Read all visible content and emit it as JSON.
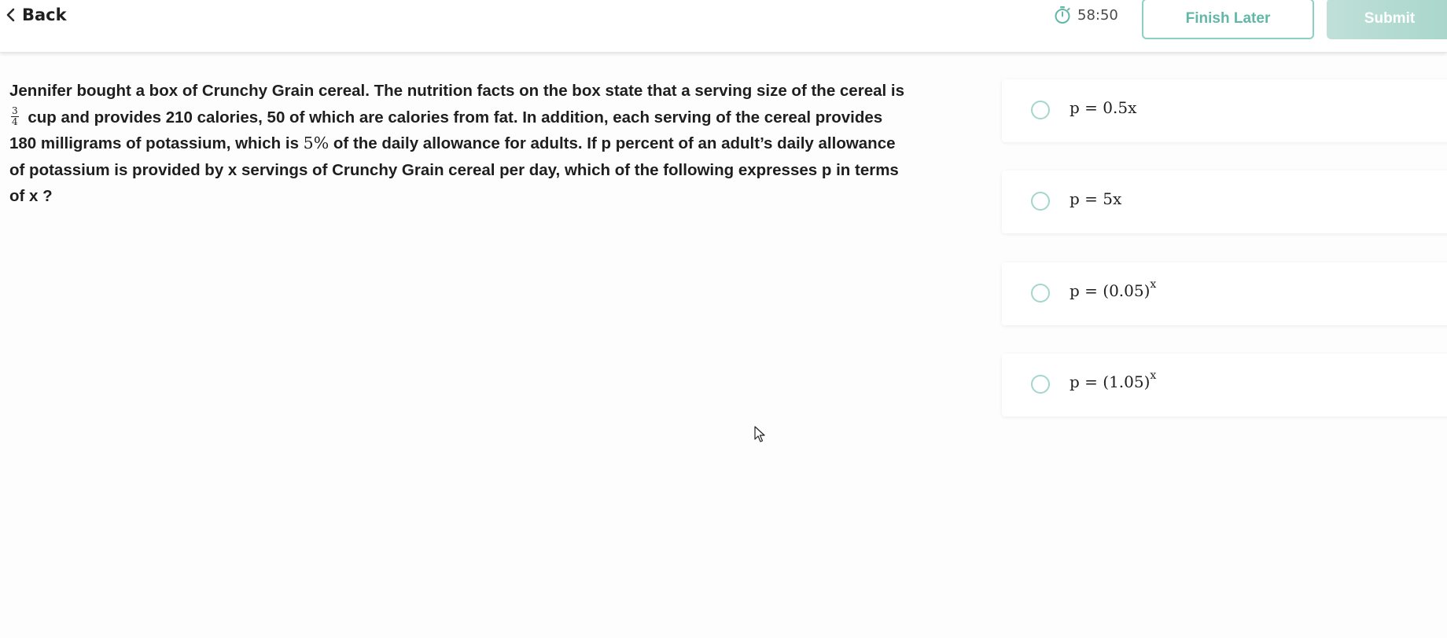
{
  "header": {
    "back_label": "Back",
    "timer": "58:50",
    "finish_later_label": "Finish Later",
    "submit_label": "Submit"
  },
  "question": {
    "line1": "Jennifer bought a box of Crunchy Grain cereal. The nutrition facts on the box state that a serving size of the cereal is",
    "fraction_numerator": "3",
    "fraction_denominator": "4",
    "line2_rest": " cup and provides 210 calories, 50 of which are calories from fat. In addition, each serving of the cereal provides",
    "line3_a": "180 milligrams of potassium, which is ",
    "line3_math": "5%",
    "line3_b": " of the daily allowance for adults. If p percent of an adult’s daily allowance",
    "line4": "of potassium is provided by x servings of Crunchy Grain cereal per day, which of the following expresses p in terms",
    "line5": "of x ?"
  },
  "choices": [
    {
      "text": "p = 0.5x",
      "exponent": ""
    },
    {
      "text": "p = 5x",
      "exponent": ""
    },
    {
      "text": "p = (0.05)",
      "exponent": "x"
    },
    {
      "text": "p = (1.05)",
      "exponent": "x"
    }
  ],
  "colors": {
    "accent": "#62b7a8",
    "accent_border": "#8ccfc3",
    "submit_bg": "#b3dad0",
    "radio_border": "#a3d6cc"
  },
  "icons": [
    "chevron-left-icon",
    "stopwatch-icon",
    "mouse-cursor-icon"
  ]
}
